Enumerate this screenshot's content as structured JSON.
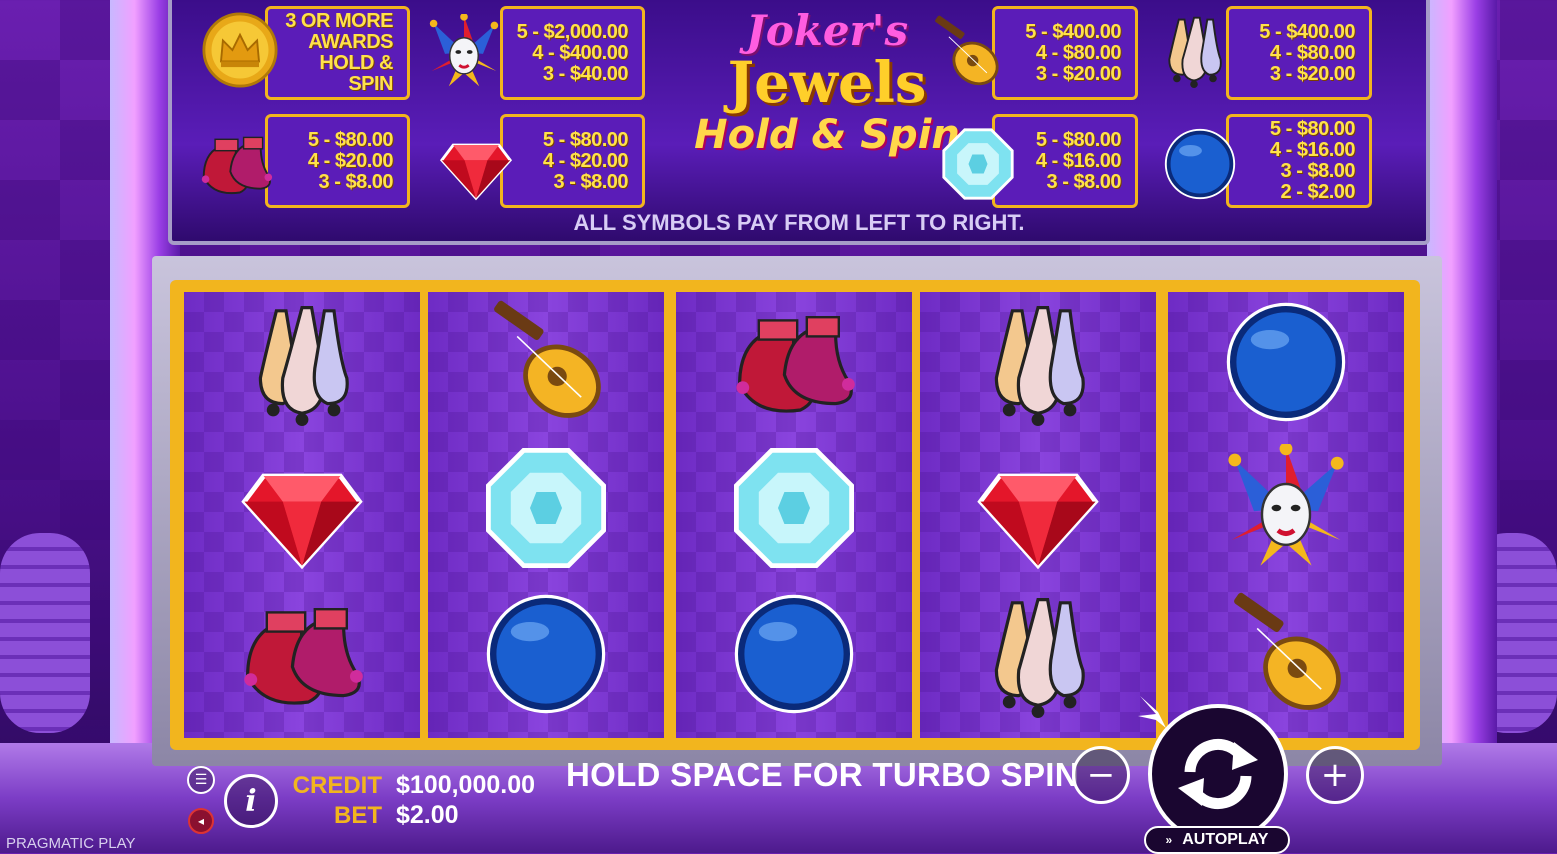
{
  "paytable": {
    "boxes": [
      {
        "lines": [
          "3 OR MORE",
          "AWARDS",
          "HOLD &",
          "SPIN"
        ],
        "icon": "crown-coin-icon"
      },
      {
        "lines": [
          "5 - $2,000.00",
          "4 - $400.00",
          "3 - $40.00"
        ],
        "icon": "joker-icon"
      },
      {
        "lines": [
          "5 - $400.00",
          "4 - $80.00",
          "3 - $20.00"
        ],
        "icon": "lute-icon"
      },
      {
        "lines": [
          "5 - $400.00",
          "4 - $80.00",
          "3 - $20.00"
        ],
        "icon": "juggling-pins-icon"
      },
      {
        "lines": [
          "5 - $80.00",
          "4 - $20.00",
          "3 - $8.00"
        ],
        "icon": "jester-shoes-icon"
      },
      {
        "lines": [
          "5 - $80.00",
          "4 - $20.00",
          "3 - $8.00"
        ],
        "icon": "red-gem-icon"
      },
      {
        "lines": [
          "5 - $80.00",
          "4 - $16.00",
          "3 - $8.00"
        ],
        "icon": "cyan-gem-icon"
      },
      {
        "lines": [
          "5 - $80.00",
          "4 - $16.00",
          "3 - $8.00",
          "2 - $2.00"
        ],
        "icon": "blue-orb-icon"
      }
    ],
    "title": {
      "line1": "Joker's",
      "line2": "Jewels",
      "line3": "Hold & Spin"
    },
    "footer": "ALL SYMBOLS PAY FROM LEFT TO RIGHT."
  },
  "reels": [
    [
      "juggling-pins-icon",
      "red-gem-icon",
      "jester-shoes-icon"
    ],
    [
      "lute-icon",
      "cyan-gem-icon",
      "blue-orb-icon"
    ],
    [
      "jester-shoes-icon",
      "cyan-gem-icon",
      "blue-orb-icon"
    ],
    [
      "juggling-pins-icon",
      "red-gem-icon",
      "juggling-pins-icon"
    ],
    [
      "blue-orb-icon",
      "joker-icon",
      "lute-icon"
    ]
  ],
  "bottom": {
    "credit_label": "CREDIT",
    "credit_value": "$100,000.00",
    "bet_label": "BET",
    "bet_value": "$2.00",
    "turbo_hint": "HOLD SPACE FOR TURBO SPIN",
    "autoplay_label": "AUTOPLAY",
    "info_glyph": "i",
    "minus_glyph": "−",
    "plus_glyph": "+",
    "brand": "PRAGMATIC PLAY"
  },
  "colors": {
    "gold": "#f2b51e",
    "purple": "#5b1cb8",
    "pink": "#ff5de0"
  }
}
